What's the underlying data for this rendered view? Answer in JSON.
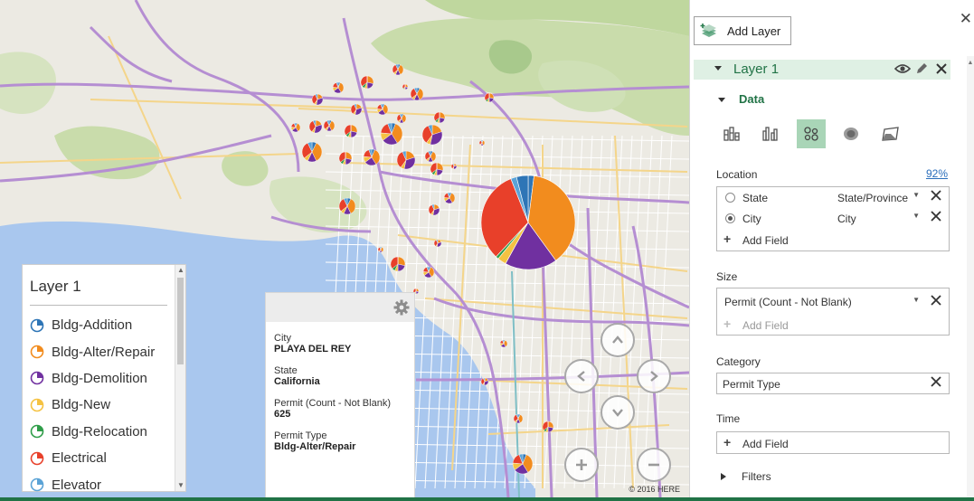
{
  "map": {
    "attribution": "© 2016 HERE",
    "colors": {
      "ocean": "#a9c7ee",
      "land": "#eceae3",
      "parks": "#c9dcab",
      "highway": "#b58ed2",
      "major_road": "#ffffff",
      "minor_road": "#f4d58a"
    }
  },
  "legend": {
    "title": "Layer 1",
    "items": [
      {
        "label": "Bldg-Addition",
        "color": "#2e75b6"
      },
      {
        "label": "Bldg-Alter/Repair",
        "color": "#f28c1e"
      },
      {
        "label": "Bldg-Demolition",
        "color": "#7030a0"
      },
      {
        "label": "Bldg-New",
        "color": "#f5c242"
      },
      {
        "label": "Bldg-Relocation",
        "color": "#2f9d49"
      },
      {
        "label": "Electrical",
        "color": "#e8402a"
      },
      {
        "label": "Elevator",
        "color": "#5ba3d6"
      }
    ]
  },
  "card": {
    "fields": [
      {
        "label": "City",
        "value": "PLAYA DEL REY"
      },
      {
        "label": "State",
        "value": "California"
      },
      {
        "label": "Permit (Count - Not Blank)",
        "value": "625"
      },
      {
        "label": "Permit Type",
        "value": "Bldg-Alter/Repair"
      }
    ]
  },
  "nav": {
    "buttons": [
      "pan-up",
      "pan-left",
      "pan-right",
      "pan-down",
      "zoom-in",
      "zoom-out"
    ]
  },
  "pane": {
    "add_layer_label": "Add Layer",
    "layer_name": "Layer 1",
    "data_section_label": "Data",
    "viz_types": [
      "stacked-column",
      "clustered-column",
      "bubble",
      "heat-map",
      "region"
    ],
    "selected_viz": "bubble",
    "location": {
      "label": "Location",
      "confidence": "92%",
      "rows": [
        {
          "field": "State",
          "type": "State/Province",
          "selected": false
        },
        {
          "field": "City",
          "type": "City",
          "selected": true
        }
      ],
      "add_field": "Add Field"
    },
    "size": {
      "label": "Size",
      "field": "Permit (Count - Not Blank)",
      "add_field": "Add Field"
    },
    "category": {
      "label": "Category",
      "field": "Permit Type"
    },
    "time": {
      "label": "Time",
      "add_field": "Add Field"
    },
    "filters_label": "Filters",
    "accent": "#217346"
  }
}
